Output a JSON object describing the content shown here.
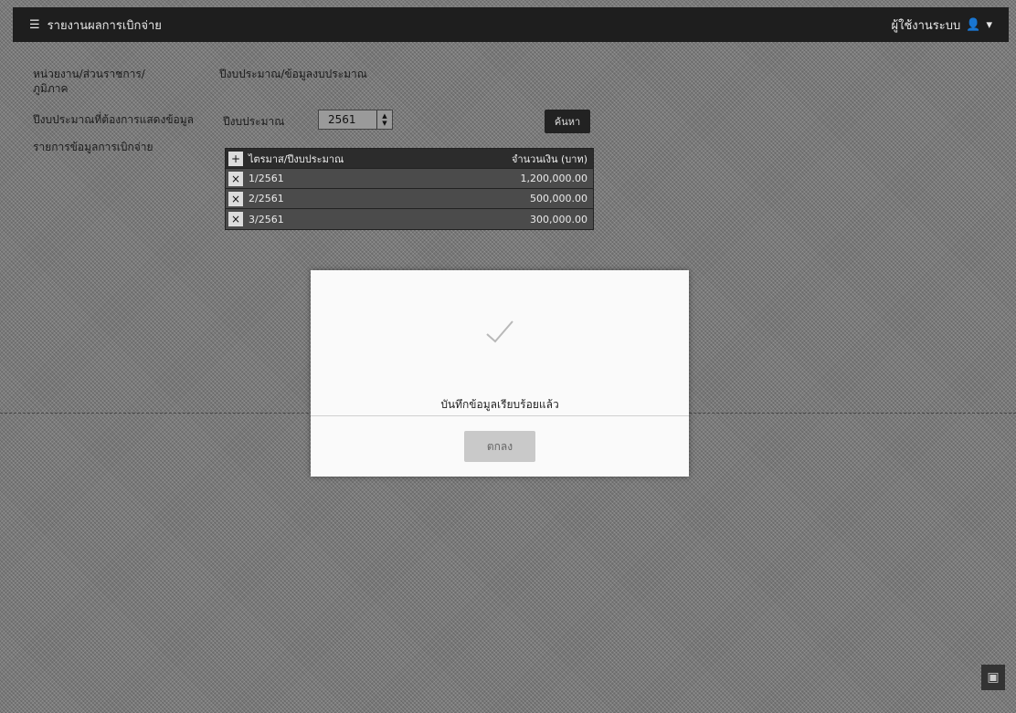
{
  "header": {
    "app_title": "รายงานผลการเบิกจ่าย",
    "user_name": "ผู้ใช้งานระบบ",
    "user_dropdown": "▾"
  },
  "labels": {
    "left1": "หน่วยงาน/ส่วนราชการ/",
    "left1b": "ภูมิภาค",
    "left1_value": "ปีงบประมาณ/ข้อมูลงบประมาณ",
    "left2": "ปีงบประมาณที่ต้องการแสดงข้อมูล",
    "year_label": "ปีงบประมาณ",
    "left3": "รายการข้อมูลการเบิกจ่าย"
  },
  "year_field": {
    "value": "2561"
  },
  "search_button": {
    "label": "ค้นหา"
  },
  "table": {
    "header": {
      "toggle": "+",
      "col1": "ไตรมาส/ปีงบประมาณ",
      "col2": "",
      "col3": "จำนวนเงิน (บาท)"
    },
    "rows": [
      {
        "toggle": "×",
        "col1": "1/2561",
        "col2": "",
        "col3": "1,200,000.00"
      },
      {
        "toggle": "×",
        "col1": "2/2561",
        "col2": "",
        "col3": "500,000.00"
      },
      {
        "toggle": "×",
        "col1": "3/2561",
        "col2": "",
        "col3": "300,000.00"
      }
    ]
  },
  "modal": {
    "message": "บันทึกข้อมูลเรียบร้อยแล้ว",
    "ok_label": "ตกลง"
  },
  "corner_icon": "▣"
}
